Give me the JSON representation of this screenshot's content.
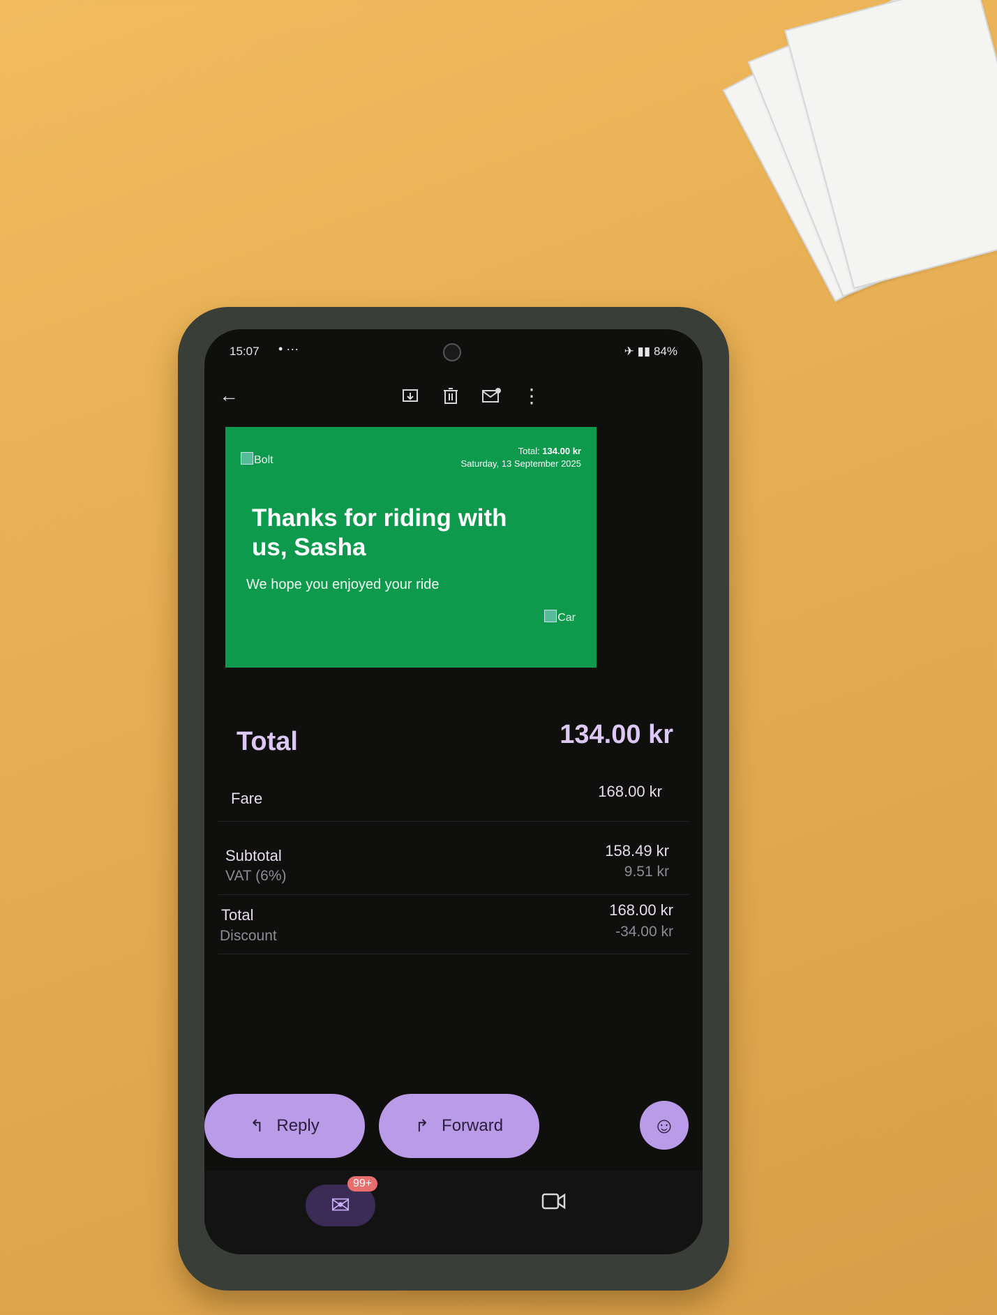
{
  "status_bar": {
    "time": "15:07",
    "extra": "• ···",
    "right": "✈ ▮▮ 84%"
  },
  "toolbar": {
    "back_icon": "arrow-left-icon",
    "icons": [
      "archive-icon",
      "trash-icon",
      "mark-unread-icon",
      "more-vert-icon"
    ]
  },
  "hero": {
    "logo_alt": "Bolt",
    "total_label": "Total:",
    "total_value": "134.00 kr",
    "date": "Saturday, 13 September 2025",
    "title": "Thanks for riding with us, Sasha",
    "subtitle": "We hope you enjoyed your ride",
    "car_alt": "Car",
    "background": "#0e9a4c"
  },
  "receipt": {
    "total_label": "Total",
    "total_value": "134.00 kr",
    "fare_label": "Fare",
    "fare_value": "168.00 kr",
    "subtotal_label": "Subtotal",
    "subtotal_value": "158.49 kr",
    "vat_label": "VAT (6%)",
    "vat_value": "9.51 kr",
    "total2_label": "Total",
    "total2_value": "168.00 kr",
    "discount_label": "Discount",
    "discount_value": "-34.00 kr"
  },
  "actions": {
    "reply": "Reply",
    "forward": "Forward",
    "accent": "#ba9be8"
  },
  "nav": {
    "badge": "99+"
  }
}
